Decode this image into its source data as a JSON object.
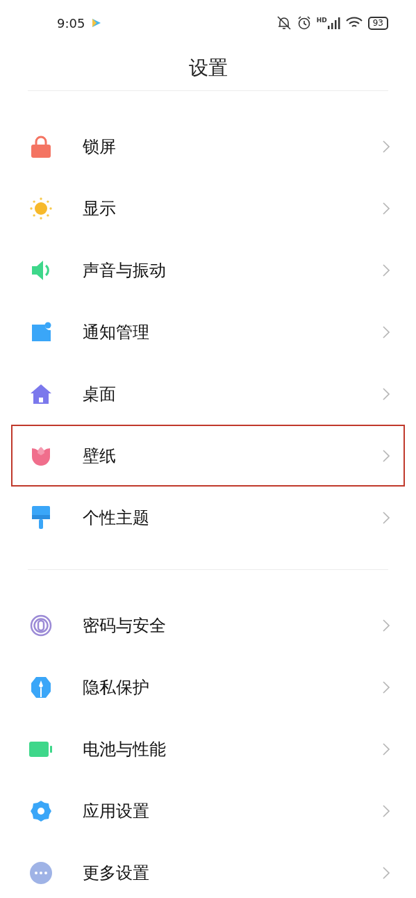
{
  "status_bar": {
    "time": "9:05",
    "network": "HD",
    "battery": "93"
  },
  "title": "设置",
  "groups": [
    {
      "items": [
        {
          "label": "锁屏",
          "highlighted": false
        },
        {
          "label": "显示",
          "highlighted": false
        },
        {
          "label": "声音与振动",
          "highlighted": false
        },
        {
          "label": "通知管理",
          "highlighted": false
        },
        {
          "label": "桌面",
          "highlighted": false
        },
        {
          "label": "壁纸",
          "highlighted": true
        },
        {
          "label": "个性主题",
          "highlighted": false
        }
      ]
    },
    {
      "items": [
        {
          "label": "密码与安全",
          "highlighted": false
        },
        {
          "label": "隐私保护",
          "highlighted": false
        },
        {
          "label": "电池与性能",
          "highlighted": false
        },
        {
          "label": "应用设置",
          "highlighted": false
        },
        {
          "label": "更多设置",
          "highlighted": false
        }
      ]
    }
  ]
}
